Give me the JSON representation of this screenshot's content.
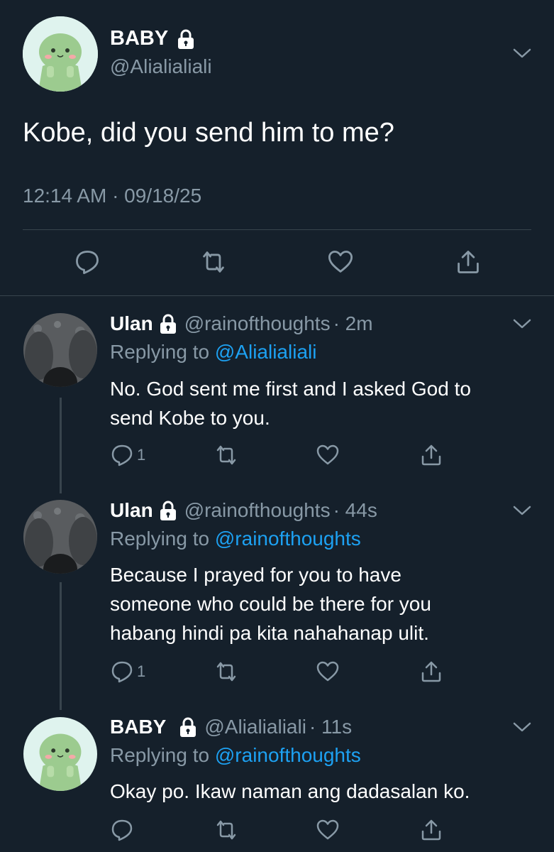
{
  "main_tweet": {
    "name": "BABY",
    "handle": "@Alialialiali",
    "text": "Kobe, did you send him to me?",
    "timestamp": "12:14 AM · 09/18/25",
    "actions": [
      "reply-icon",
      "retweet-icon",
      "like-icon",
      "share-icon"
    ]
  },
  "replies": [
    {
      "name": "Ulan",
      "handle": "@rainofthoughts",
      "time": "· 2m",
      "replying_label": "Replying to",
      "replying_handle": "@Alialialiali",
      "text_lines": [
        "No. God sent me first and I asked God to",
        "send Kobe to you."
      ],
      "reply_count": "1"
    },
    {
      "name": "Ulan",
      "handle": "@rainofthoughts",
      "time": "· 44s",
      "replying_label": "Replying to",
      "replying_handle": "@rainofthoughts",
      "text_lines": [
        "Because I prayed for you to have",
        "someone who could be there for you",
        "habang hindi pa kita nahahanap ulit."
      ],
      "reply_count": "1"
    },
    {
      "name": "BABY",
      "handle": "@Alialialiali",
      "time": "· 11s",
      "replying_label": "Replying to",
      "replying_handle": "@rainofthoughts",
      "text_lines": [
        "Okay po. Ikaw naman ang dadasalan ko."
      ],
      "reply_count": ""
    }
  ],
  "colors": {
    "background": "#15202b",
    "secondary_text": "#8899a6",
    "link": "#1da1f2",
    "divider": "#38444d"
  }
}
